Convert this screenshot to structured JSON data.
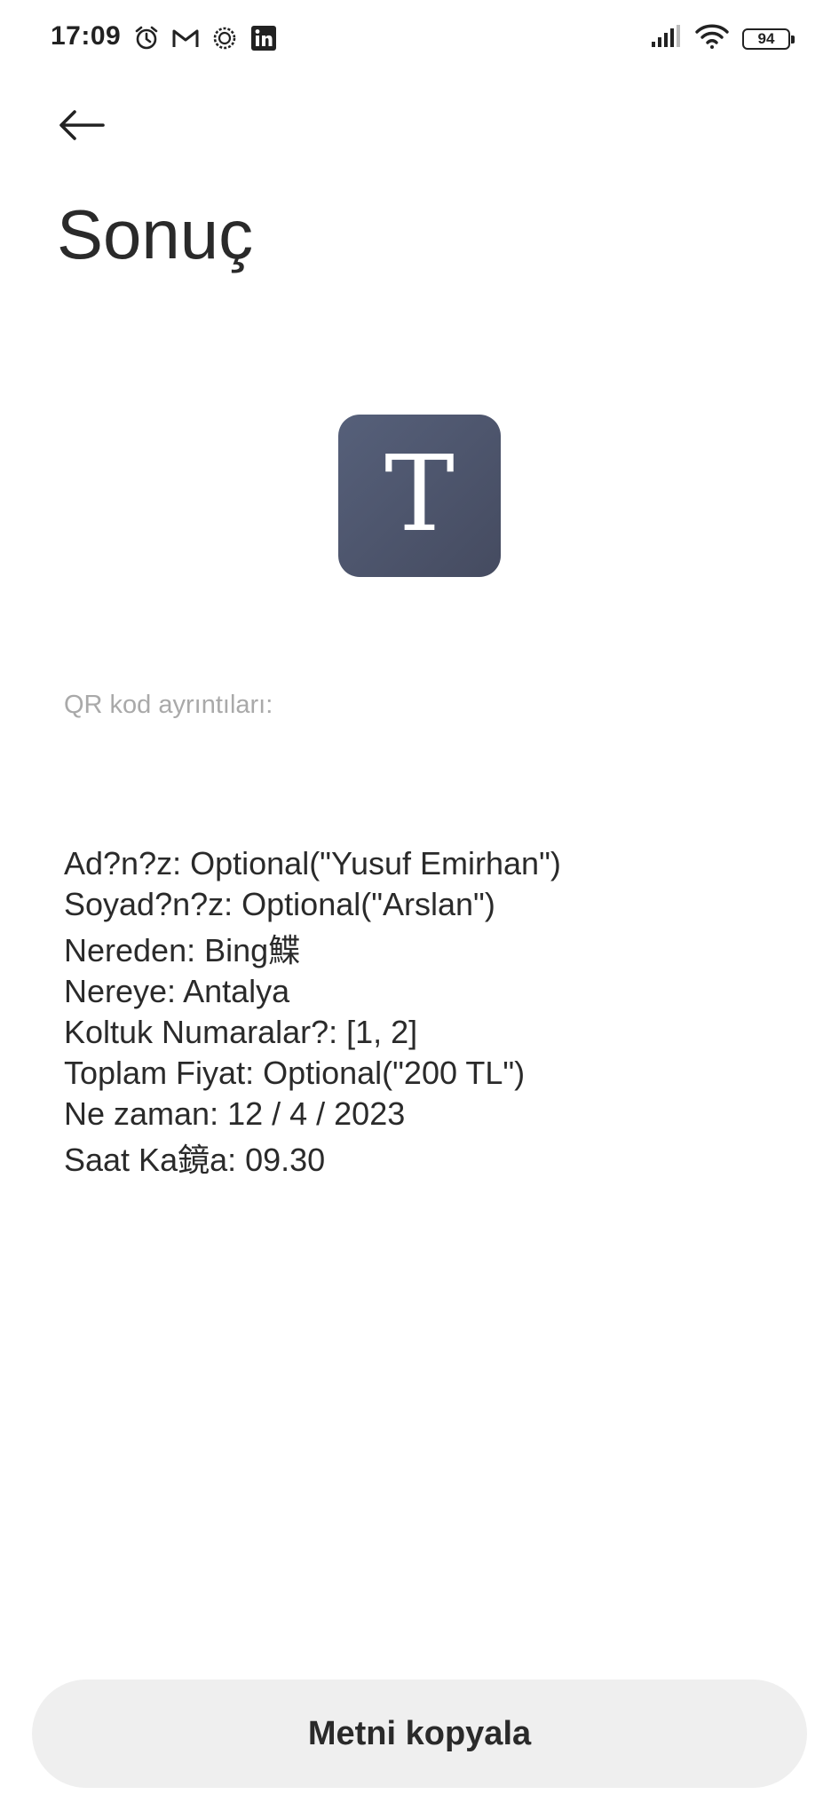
{
  "status_bar": {
    "time": "17:09",
    "battery": "94",
    "left_icons": [
      "alarm-icon",
      "gmail-icon",
      "sync-icon",
      "linkedin-icon"
    ],
    "right_icons": [
      "signal-icon",
      "wifi-icon",
      "battery-icon"
    ]
  },
  "header": {
    "title": "Sonuç"
  },
  "tile": {
    "letter": "T",
    "color": "#4f566c"
  },
  "section": {
    "label": "QR kod ayrıntıları:"
  },
  "details": {
    "lines": [
      "Ad?n?z: Optional(\"Yusuf Emirhan\")",
      "Soyad?n?z: Optional(\"Arslan\")",
      "Nereden: Bing鰈",
      "Nereye: Antalya",
      "Koltuk Numaralar?: [1, 2]",
      "Toplam Fiyat: Optional(\"200 TL\")",
      "Ne zaman: 12 / 4 / 2023",
      "Saat Ka鏡a: 09.30"
    ]
  },
  "actions": {
    "copy_label": "Metni kopyala"
  }
}
